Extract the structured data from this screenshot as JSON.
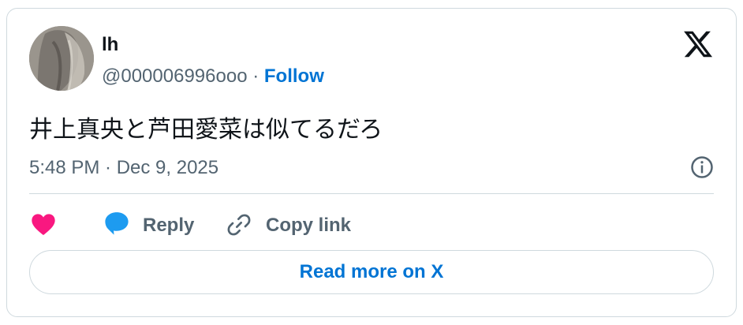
{
  "author": {
    "display_name": "lh",
    "handle": "@000006996ooo",
    "separator": "·",
    "follow_label": "Follow"
  },
  "tweet": {
    "text": "井上真央と芦田愛菜は似てるだろ",
    "timestamp": "5:48 PM · Dec 9, 2025"
  },
  "actions": {
    "like_icon": "heart-icon",
    "reply_label": "Reply",
    "copy_link_label": "Copy link"
  },
  "footer": {
    "read_more_label": "Read more on X"
  },
  "colors": {
    "accent": "#0074d4",
    "like": "#f91880",
    "reply_icon": "#1d9bf0",
    "muted": "#536471",
    "border": "#cfd9de"
  }
}
